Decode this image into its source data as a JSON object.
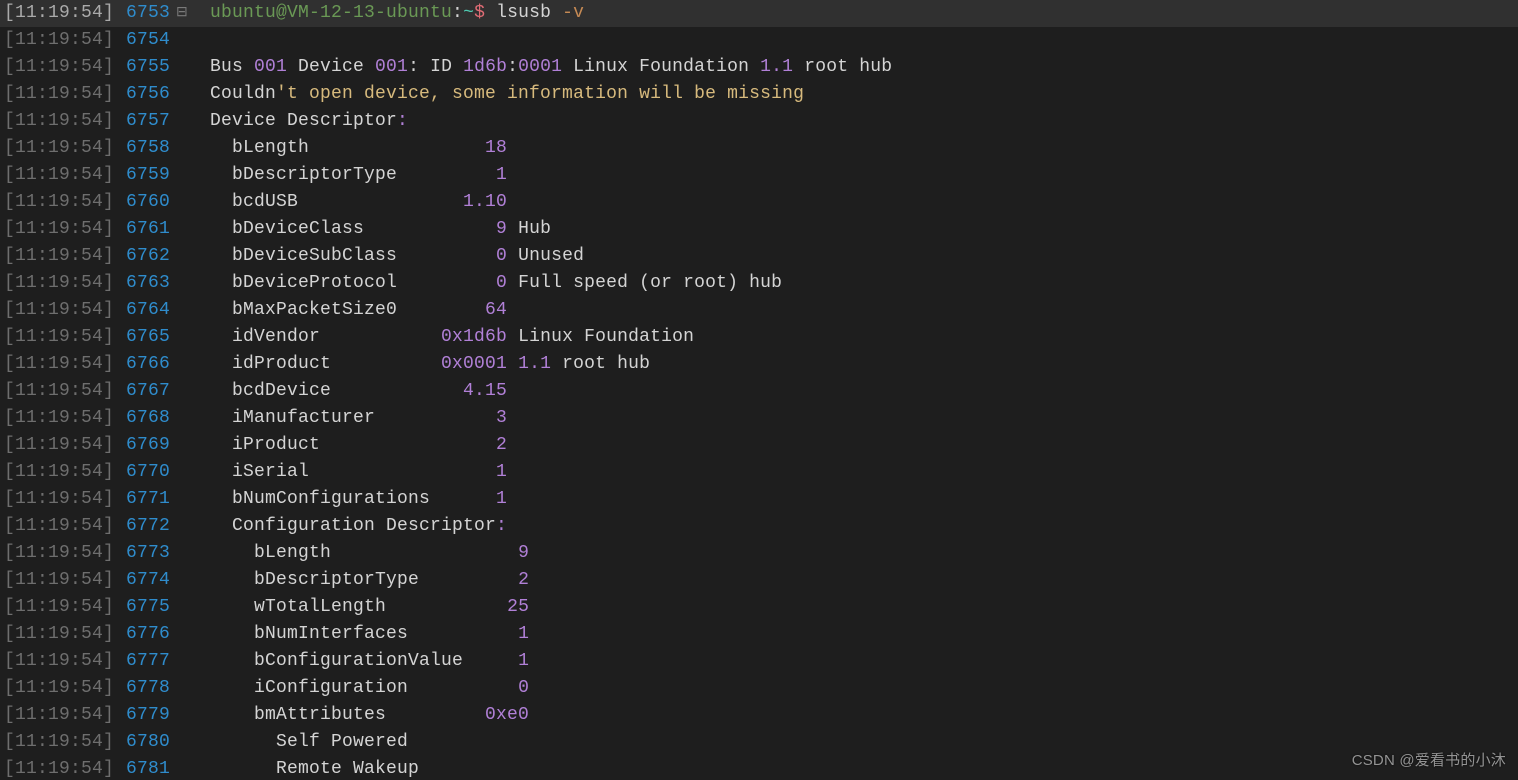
{
  "prompt_prefix": "ubuntu@VM-12-13-ubuntu",
  "prompt_path": "~",
  "prompt_symbol": "$",
  "watermark": "CSDN @爱看书的小沐",
  "timestamp": "[11:19:54]",
  "fold_glyph": "⊟",
  "lines": [
    {
      "ln": 6753,
      "hl": true,
      "fold": true,
      "segs": [
        {
          "t": "ubuntu@VM-12-13-ubuntu",
          "c": "c-green"
        },
        {
          "t": ":",
          "c": "c-white"
        },
        {
          "t": "~",
          "c": "c-cyan"
        },
        {
          "t": "$ ",
          "c": "c-red"
        },
        {
          "t": "lsusb ",
          "c": "c-white"
        },
        {
          "t": "-v",
          "c": "c-orange"
        }
      ]
    },
    {
      "ln": 6754,
      "segs": [
        {
          "t": "",
          "c": "c-white"
        }
      ]
    },
    {
      "ln": 6755,
      "segs": [
        {
          "t": "Bus ",
          "c": "c-white"
        },
        {
          "t": "001",
          "c": "c-num"
        },
        {
          "t": " Device ",
          "c": "c-white"
        },
        {
          "t": "001",
          "c": "c-num"
        },
        {
          "t": ": ID ",
          "c": "c-white"
        },
        {
          "t": "1d6b",
          "c": "c-num"
        },
        {
          "t": ":",
          "c": "c-white"
        },
        {
          "t": "0001",
          "c": "c-num"
        },
        {
          "t": " Linux Foundation ",
          "c": "c-white"
        },
        {
          "t": "1.1",
          "c": "c-num"
        },
        {
          "t": " root hub",
          "c": "c-white"
        }
      ]
    },
    {
      "ln": 6756,
      "segs": [
        {
          "t": "Couldn",
          "c": "c-white"
        },
        {
          "t": "'t open device, some information will be missing",
          "c": "c-yellow"
        }
      ]
    },
    {
      "ln": 6757,
      "segs": [
        {
          "t": "Device Descriptor",
          "c": "c-white"
        },
        {
          "t": ":",
          "c": "c-num"
        }
      ]
    },
    {
      "ln": 6758,
      "segs": [
        {
          "t": "  bLength                ",
          "c": "c-white"
        },
        {
          "t": "18",
          "c": "c-num"
        }
      ]
    },
    {
      "ln": 6759,
      "segs": [
        {
          "t": "  bDescriptorType         ",
          "c": "c-white"
        },
        {
          "t": "1",
          "c": "c-num"
        }
      ]
    },
    {
      "ln": 6760,
      "segs": [
        {
          "t": "  bcdUSB               ",
          "c": "c-white"
        },
        {
          "t": "1.10",
          "c": "c-num"
        }
      ]
    },
    {
      "ln": 6761,
      "segs": [
        {
          "t": "  bDeviceClass            ",
          "c": "c-white"
        },
        {
          "t": "9",
          "c": "c-num"
        },
        {
          "t": " Hub",
          "c": "c-white"
        }
      ]
    },
    {
      "ln": 6762,
      "segs": [
        {
          "t": "  bDeviceSubClass         ",
          "c": "c-white"
        },
        {
          "t": "0",
          "c": "c-num"
        },
        {
          "t": " Unused",
          "c": "c-white"
        }
      ]
    },
    {
      "ln": 6763,
      "segs": [
        {
          "t": "  bDeviceProtocol         ",
          "c": "c-white"
        },
        {
          "t": "0",
          "c": "c-num"
        },
        {
          "t": " Full speed (or root) hub",
          "c": "c-white"
        }
      ]
    },
    {
      "ln": 6764,
      "segs": [
        {
          "t": "  bMaxPacketSize0        ",
          "c": "c-white"
        },
        {
          "t": "64",
          "c": "c-num"
        }
      ]
    },
    {
      "ln": 6765,
      "segs": [
        {
          "t": "  idVendor           ",
          "c": "c-white"
        },
        {
          "t": "0x1d6b",
          "c": "c-num"
        },
        {
          "t": " Linux Foundation",
          "c": "c-white"
        }
      ]
    },
    {
      "ln": 6766,
      "segs": [
        {
          "t": "  idProduct          ",
          "c": "c-white"
        },
        {
          "t": "0x0001",
          "c": "c-num"
        },
        {
          "t": " ",
          "c": "c-white"
        },
        {
          "t": "1.1",
          "c": "c-num"
        },
        {
          "t": " root hub",
          "c": "c-white"
        }
      ]
    },
    {
      "ln": 6767,
      "segs": [
        {
          "t": "  bcdDevice            ",
          "c": "c-white"
        },
        {
          "t": "4.15",
          "c": "c-num"
        }
      ]
    },
    {
      "ln": 6768,
      "segs": [
        {
          "t": "  iManufacturer           ",
          "c": "c-white"
        },
        {
          "t": "3",
          "c": "c-num"
        }
      ]
    },
    {
      "ln": 6769,
      "segs": [
        {
          "t": "  iProduct                ",
          "c": "c-white"
        },
        {
          "t": "2",
          "c": "c-num"
        }
      ]
    },
    {
      "ln": 6770,
      "segs": [
        {
          "t": "  iSerial                 ",
          "c": "c-white"
        },
        {
          "t": "1",
          "c": "c-num"
        }
      ]
    },
    {
      "ln": 6771,
      "segs": [
        {
          "t": "  bNumConfigurations      ",
          "c": "c-white"
        },
        {
          "t": "1",
          "c": "c-num"
        }
      ]
    },
    {
      "ln": 6772,
      "segs": [
        {
          "t": "  Configuration Descriptor",
          "c": "c-white"
        },
        {
          "t": ":",
          "c": "c-num"
        }
      ]
    },
    {
      "ln": 6773,
      "segs": [
        {
          "t": "    bLength                 ",
          "c": "c-white"
        },
        {
          "t": "9",
          "c": "c-num"
        }
      ]
    },
    {
      "ln": 6774,
      "segs": [
        {
          "t": "    bDescriptorType         ",
          "c": "c-white"
        },
        {
          "t": "2",
          "c": "c-num"
        }
      ]
    },
    {
      "ln": 6775,
      "segs": [
        {
          "t": "    wTotalLength           ",
          "c": "c-white"
        },
        {
          "t": "25",
          "c": "c-num"
        }
      ]
    },
    {
      "ln": 6776,
      "segs": [
        {
          "t": "    bNumInterfaces          ",
          "c": "c-white"
        },
        {
          "t": "1",
          "c": "c-num"
        }
      ]
    },
    {
      "ln": 6777,
      "segs": [
        {
          "t": "    bConfigurationValue     ",
          "c": "c-white"
        },
        {
          "t": "1",
          "c": "c-num"
        }
      ]
    },
    {
      "ln": 6778,
      "segs": [
        {
          "t": "    iConfiguration          ",
          "c": "c-white"
        },
        {
          "t": "0",
          "c": "c-num"
        }
      ]
    },
    {
      "ln": 6779,
      "segs": [
        {
          "t": "    bmAttributes         ",
          "c": "c-white"
        },
        {
          "t": "0xe0",
          "c": "c-num"
        }
      ]
    },
    {
      "ln": 6780,
      "segs": [
        {
          "t": "      Self Powered",
          "c": "c-white"
        }
      ]
    },
    {
      "ln": 6781,
      "segs": [
        {
          "t": "      Remote Wakeup",
          "c": "c-white"
        }
      ]
    }
  ]
}
